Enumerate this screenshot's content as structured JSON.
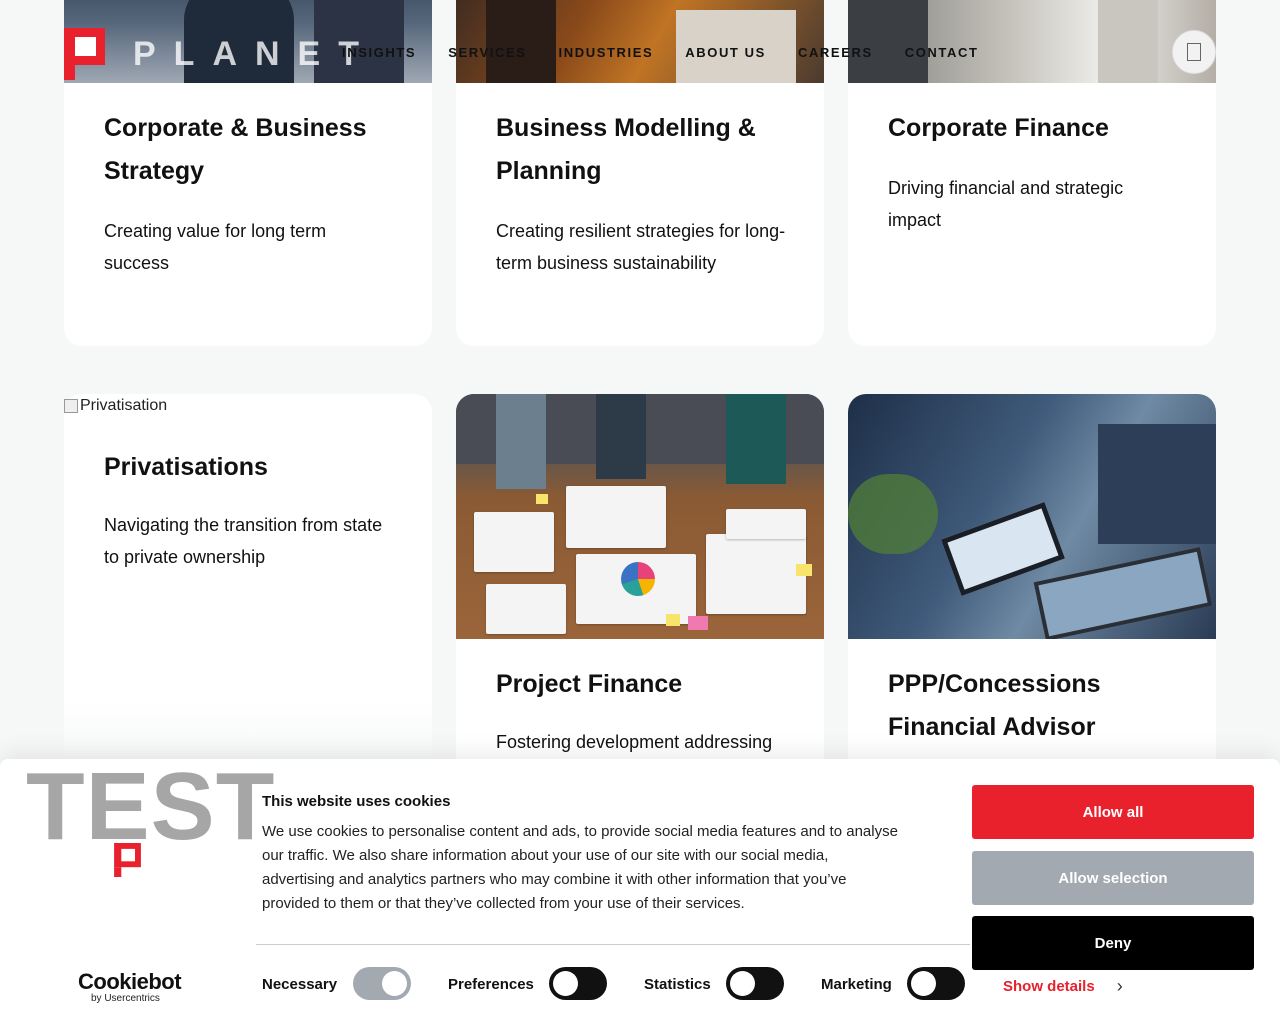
{
  "header": {
    "logo_text": "PLANET",
    "nav": [
      "INSIGHTS",
      "SERVICES",
      "INDUSTRIES",
      "ABOUT US",
      "CAREERS",
      "CONTACT"
    ]
  },
  "cards": [
    {
      "title": "Corporate & Business Strategy",
      "text": "Creating value for long term success"
    },
    {
      "title": "Business Modelling & Planning",
      "text": "Creating resilient strategies for long-term business sustainability"
    },
    {
      "title": "Corporate Finance",
      "text": "Driving financial and strategic impact"
    },
    {
      "image_alt": "Privatisation",
      "title": "Privatisations",
      "text": "Navigating the transition from state to private ownership"
    },
    {
      "title": "Project Finance",
      "text": "Fostering development addressing"
    },
    {
      "title": "PPP/Concessions Financial Advisor",
      "text": ""
    }
  ],
  "cookie": {
    "brand_text": "TEST",
    "title": "This website uses cookies",
    "description": "We use cookies to personalise content and ads, to provide social media features and to analyse our traffic. We also share information about your use of our site with our social media, advertising and analytics partners who may combine it with other information that you’ve provided to them or that they’ve collected from your use of their services.",
    "cookiebot_name": "Cookiebot",
    "cookiebot_by": "by Usercentrics",
    "toggles": [
      {
        "label": "Necessary",
        "on": true
      },
      {
        "label": "Preferences",
        "on": false
      },
      {
        "label": "Statistics",
        "on": false
      },
      {
        "label": "Marketing",
        "on": false
      }
    ],
    "show_details": "Show details",
    "allow_all": "Allow all",
    "allow_selection": "Allow selection",
    "deny": "Deny"
  },
  "colors": {
    "accent": "#e8212c",
    "gray_button": "#a3a9b1",
    "dark": "#000000"
  },
  "icons": [
    "menu-icon",
    "broken-image-icon",
    "chevron-right-icon",
    "planet-logo-mark"
  ]
}
